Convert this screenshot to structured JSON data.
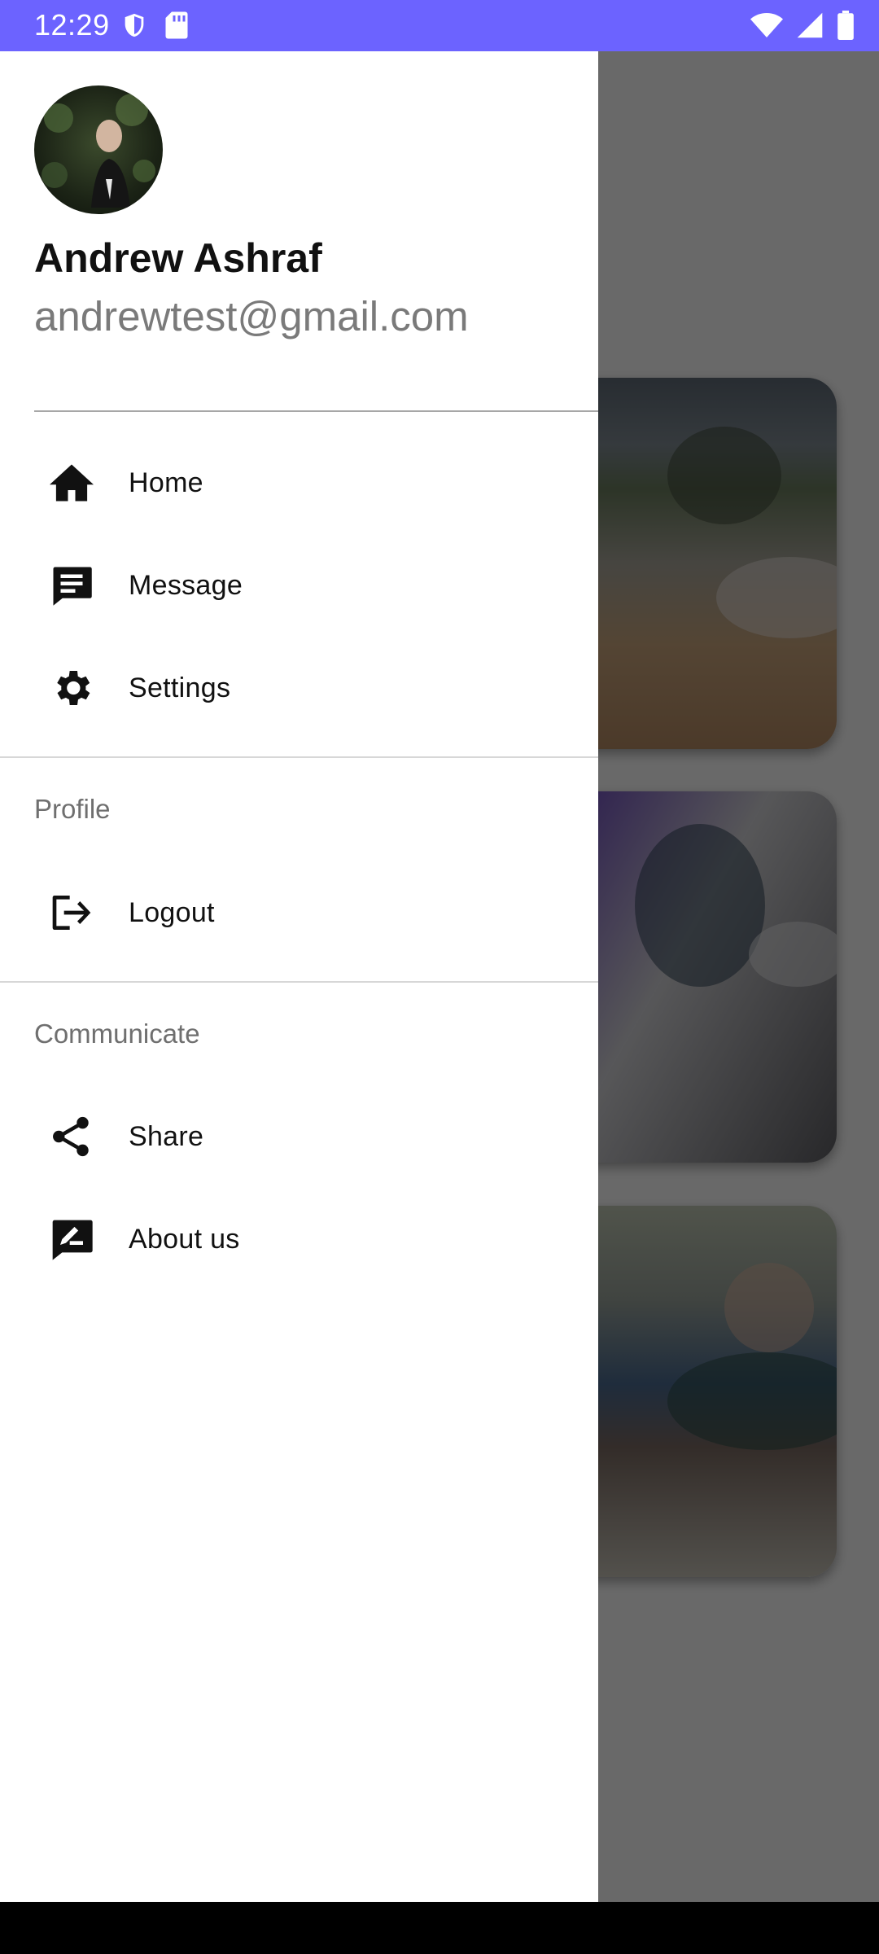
{
  "status_bar": {
    "time": "12:29",
    "icons_left": [
      "shield-icon",
      "sd-card-icon"
    ],
    "icons_right": [
      "wifi-icon",
      "cell-signal-icon",
      "battery-icon"
    ],
    "color": "#6c63ff"
  },
  "drawer": {
    "profile": {
      "name": "Andrew Ashraf",
      "email": "andrewtest@gmail.com"
    },
    "main_items": [
      {
        "label": "Home",
        "icon": "home-icon"
      },
      {
        "label": "Message",
        "icon": "message-icon"
      },
      {
        "label": "Settings",
        "icon": "gear-icon"
      }
    ],
    "sections": [
      {
        "title": "Profile",
        "items": [
          {
            "label": "Logout",
            "icon": "logout-icon"
          }
        ]
      },
      {
        "title": "Communicate",
        "items": [
          {
            "label": "Share",
            "icon": "share-icon"
          },
          {
            "label": "About us",
            "icon": "feedback-icon"
          }
        ]
      }
    ]
  },
  "background": {
    "cards": [
      "classroom-photo-1",
      "classroom-photo-2",
      "classroom-photo-3"
    ]
  },
  "colors": {
    "accent": "#6c63ff",
    "scrim": "rgba(0,0,0,0.58)",
    "text_primary": "#111111",
    "text_secondary": "#7a7a7a"
  }
}
